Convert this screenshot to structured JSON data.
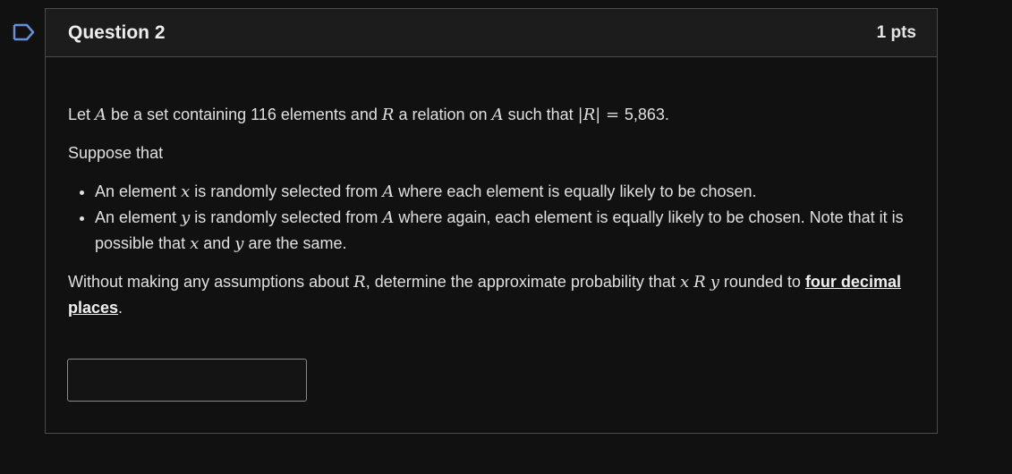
{
  "question": {
    "title": "Question 2",
    "points": "1 pts"
  },
  "body": {
    "p1": {
      "t1": "Let ",
      "set": "A",
      "t2": " be a set containing 116 elements and ",
      "rel": "R",
      "t3": " a relation on ",
      "set2": "A",
      "t4": " such that ",
      "card": "|R|",
      "eq": " = ",
      "t5": "5,863."
    },
    "p2": "Suppose that",
    "bullets": [
      {
        "a": "An element ",
        "var": "x",
        "b": " is randomly selected from ",
        "set": "A",
        "c": " where each element is equally likely to be chosen."
      },
      {
        "a": "An element ",
        "var": "y",
        "b": " is randomly selected from ",
        "set": "A",
        "c": " where again, each element is equally likely to be chosen. Note that it is possible that ",
        "x": "x",
        "d": " and ",
        "y": "y",
        "e": " are the same."
      }
    ],
    "p3": {
      "a": "Without making any assumptions about ",
      "rel": "R",
      "b": ", determine the approximate probability that ",
      "expr_x": "x",
      "expr_r": "R",
      "expr_y": "y",
      "c": " rounded to ",
      "link": "four decimal places",
      "d": "."
    }
  },
  "answer": {
    "value": "",
    "placeholder": ""
  },
  "icons": {
    "flag": "bookmark-flag-icon"
  },
  "colors": {
    "background": "#111111",
    "header": "#1c1c1c",
    "border": "#4a4a4a"
  }
}
